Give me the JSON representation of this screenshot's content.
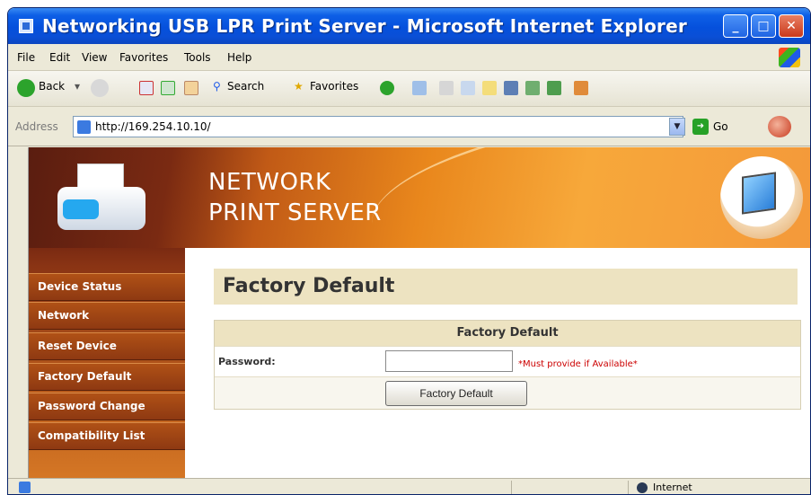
{
  "window": {
    "title": "Networking USB LPR Print Server - Microsoft Internet Explorer"
  },
  "menu": {
    "items": [
      "File",
      "Edit",
      "View",
      "Favorites",
      "Tools",
      "Help"
    ]
  },
  "toolbar": {
    "back_label": "Back",
    "search_label": "Search",
    "favorites_label": "Favorites"
  },
  "address": {
    "label": "Address",
    "url": "http://169.254.10.10/",
    "go_label": "Go"
  },
  "banner": {
    "line1": "NETWORK",
    "line2": "PRINT SERVER"
  },
  "sidebar": {
    "items": [
      {
        "label": "Device Status"
      },
      {
        "label": "Network"
      },
      {
        "label": "Reset Device"
      },
      {
        "label": "Factory Default"
      },
      {
        "label": "Password Change"
      },
      {
        "label": "Compatibility List"
      }
    ]
  },
  "main": {
    "page_title": "Factory Default",
    "form_header": "Factory Default",
    "password_label": "Password:",
    "password_value": "",
    "password_note": "*Must provide if Available*",
    "submit_label": "Factory Default"
  },
  "status": {
    "zone": "Internet"
  },
  "colors": {
    "titlebar": "#0550dc",
    "banner_orange": "#e9871c",
    "sidebar_brown": "#8e3912",
    "panel_beige": "#ede3c1",
    "note_red": "#cc0000"
  }
}
